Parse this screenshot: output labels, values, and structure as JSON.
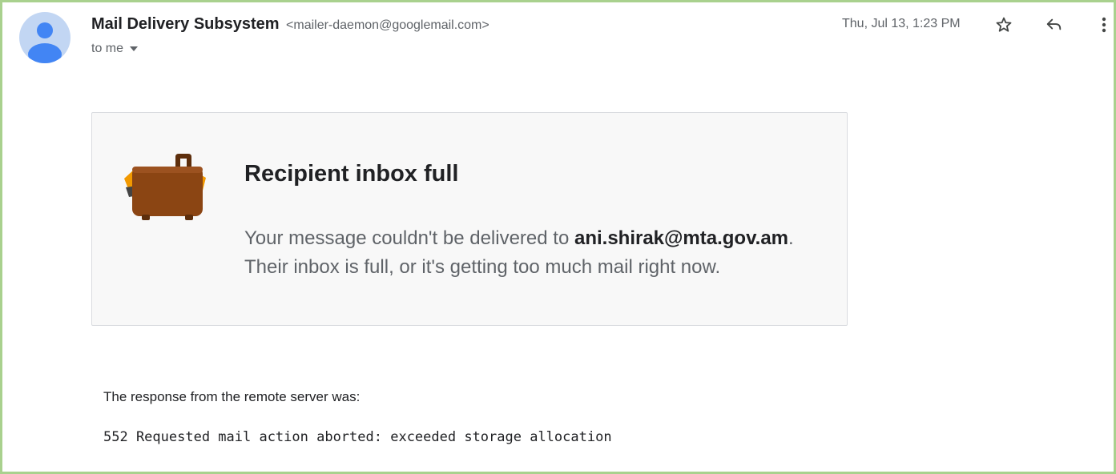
{
  "header": {
    "sender_name": "Mail Delivery Subsystem",
    "sender_email": "<mailer-daemon@googlemail.com>",
    "recipient_label": "to me",
    "date": "Thu, Jul 13, 1:23 PM",
    "avatar_icon": "person-icon",
    "actions": {
      "star_icon": "star-outline-icon",
      "reply_icon": "reply-arrow-icon",
      "more_icon": "vertical-dots-icon"
    }
  },
  "notice": {
    "icon": "suitcase-icon",
    "title": "Recipient inbox full",
    "message_prefix": "Your message couldn't be delivered to ",
    "recipient_address": "ani.shirak@mta.gov.am",
    "message_suffix": ".",
    "message_line2": "Their inbox is full, or it's getting too much mail right now."
  },
  "response": {
    "intro": "The response from the remote server was:",
    "code": "552 Requested mail action aborted: exceeded storage allocation"
  },
  "colors": {
    "frame_border": "#a9d18e",
    "avatar_bg": "#c2d6f3",
    "avatar_fg": "#4285f4",
    "suitcase_body": "#8b4513",
    "suitcase_accent": "#f29900",
    "card_bg": "#f8f8f8"
  }
}
